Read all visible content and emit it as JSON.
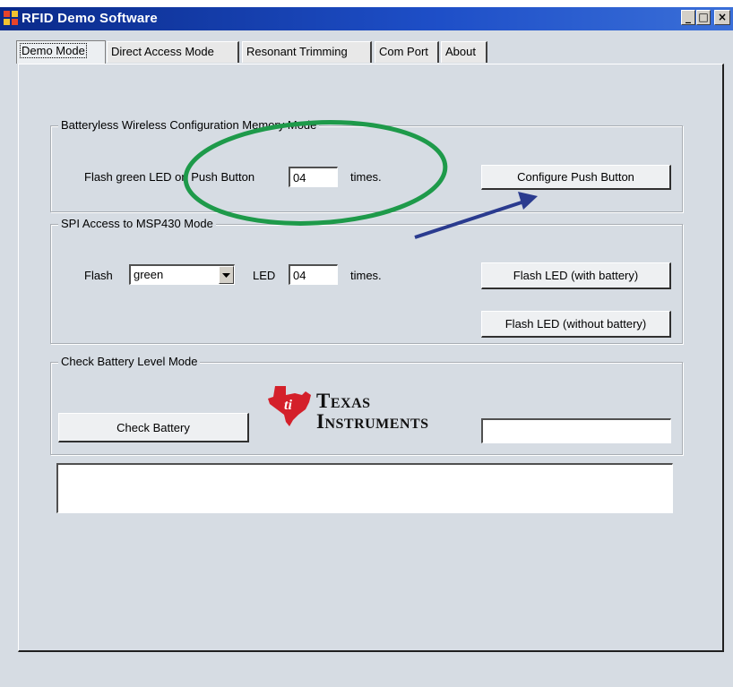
{
  "window": {
    "title": "RFID Demo Software",
    "controls": {
      "minimize": "_",
      "maximize": "□",
      "close": "×"
    }
  },
  "tabs": [
    {
      "label": "Demo Mode",
      "active": true
    },
    {
      "label": "Direct Access Mode",
      "active": false
    },
    {
      "label": "Resonant Trimming",
      "active": false
    },
    {
      "label": "Com Port",
      "active": false
    },
    {
      "label": "About",
      "active": false
    }
  ],
  "batteryless": {
    "legend": "Batteryless Wireless  Configuration Memory Mode",
    "flash_label": "Flash green LED on Push Button",
    "count_value": "04",
    "times_label": "times.",
    "configure_button": "Configure Push Button"
  },
  "spi": {
    "legend": "SPI Access to MSP430 Mode",
    "flash_label": "Flash",
    "color_selected": "green",
    "led_label": "LED",
    "count_value": "04",
    "times_label": "times.",
    "flash_with_battery_button": "Flash LED (with battery)",
    "flash_without_battery_button": "Flash LED (without battery)"
  },
  "battery": {
    "legend": "Check Battery Level Mode",
    "check_button": "Check Battery",
    "result_value": "",
    "logo_line1": "Texas",
    "logo_line2": "Instruments"
  },
  "status_box_value": "",
  "annotation": {
    "ellipse_color": "#1e9a4a",
    "arrow_color": "#2a3b8f"
  }
}
